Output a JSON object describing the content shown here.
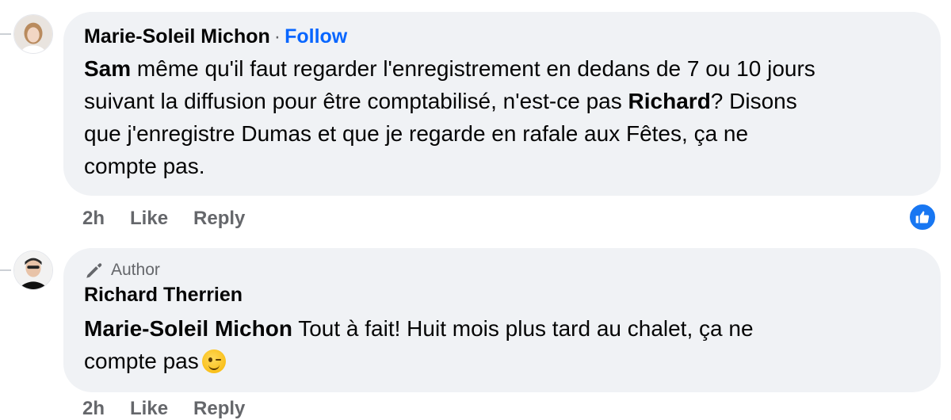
{
  "comments": [
    {
      "author": "Marie-Soleil Michon",
      "separator": "·",
      "follow_label": "Follow",
      "text_parts": {
        "mention_1": "Sam",
        "part_1": " même qu'il faut regarder l'enregistrement en dedans de 7 ou 10 jours",
        "part_2": "suivant la diffusion pour être comptabilisé, n'est-ce pas ",
        "mention_2": "Richard",
        "part_3": "? Disons",
        "part_4": "que j'enregistre Dumas et que je regarde en rafale aux Fêtes, ça ne",
        "part_5": "compte pas."
      },
      "time": "2h",
      "like_label": "Like",
      "reply_label": "Reply",
      "reaction_icon": "thumbs-up-icon"
    },
    {
      "badge_label": "Author",
      "badge_icon": "pen-icon",
      "author": "Richard Therrien",
      "text_parts": {
        "mention_1": "Marie-Soleil Michon",
        "part_1": " Tout à fait! Huit mois plus tard au chalet, ça ne",
        "part_2": "compte pas"
      },
      "emoji": "winking-face-emoji",
      "time": "2h",
      "like_label": "Like",
      "reply_label": "Reply"
    }
  ],
  "colors": {
    "bubble_bg": "#f0f2f5",
    "link_blue": "#0866ff",
    "meta_gray": "#65676b",
    "like_blue": "#1877f2"
  }
}
